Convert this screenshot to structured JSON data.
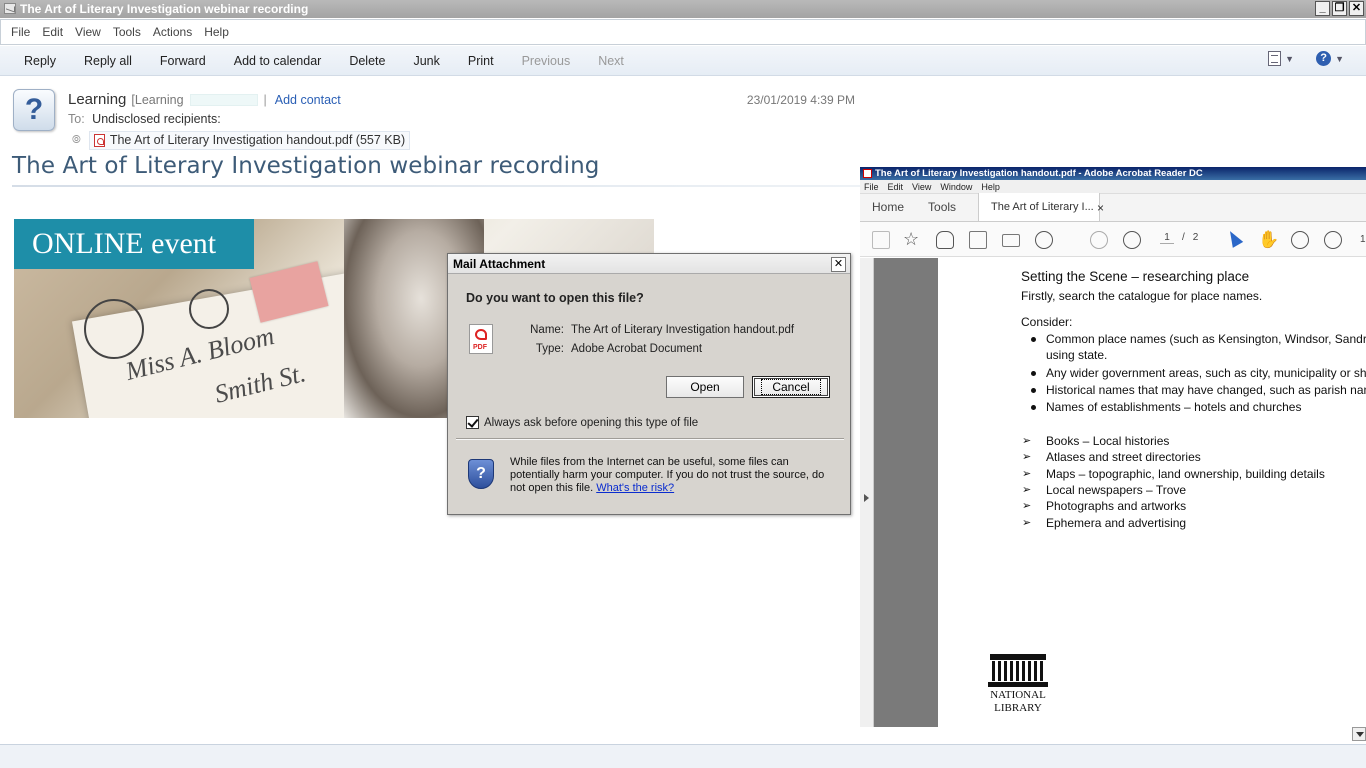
{
  "window": {
    "title": "The Art of Literary Investigation webinar recording",
    "controls": [
      "_",
      "❐",
      "✕"
    ]
  },
  "menu": [
    "File",
    "Edit",
    "View",
    "Tools",
    "Actions",
    "Help"
  ],
  "toolbar": {
    "buttons": [
      {
        "label": "Reply",
        "enabled": true
      },
      {
        "label": "Reply all",
        "enabled": true
      },
      {
        "label": "Forward",
        "enabled": true
      },
      {
        "label": "Add to calendar",
        "enabled": true
      },
      {
        "label": "Delete",
        "enabled": true
      },
      {
        "label": "Junk",
        "enabled": true
      },
      {
        "label": "Print",
        "enabled": true
      },
      {
        "label": "Previous",
        "enabled": false
      },
      {
        "label": "Next",
        "enabled": false
      }
    ],
    "right_icons": [
      "view-options-icon",
      "help-icon"
    ]
  },
  "message": {
    "from_name": "Learning",
    "from_bracket": "[Learning",
    "separator": "|",
    "add_contact": "Add contact",
    "date": "23/01/2019 4:39 PM",
    "to_label": "To:",
    "to_value": "Undisclosed recipients:",
    "attachment": "The Art of Literary Investigation handout.pdf (557 KB)",
    "subject": "The Art of Literary Investigation webinar recording",
    "banner_text": "ONLINE event"
  },
  "dialog": {
    "title": "Mail Attachment",
    "close": "✕",
    "question": "Do you want to open this file?",
    "name_label": "Name:",
    "name_value": "The Art of Literary Investigation handout.pdf",
    "type_label": "Type:",
    "type_value": "Adobe Acrobat Document",
    "open_button": "Open",
    "cancel_button": "Cancel",
    "checkbox_label": "Always ask before opening this type of file",
    "checkbox_checked": true,
    "warning_text": "While files from the Internet can be useful, some files can potentially harm your computer. If you do not trust the source, do not open this file.",
    "risk_link": "What's the risk?"
  },
  "acrobat": {
    "title": "The Art of Literary Investigation handout.pdf - Adobe Acrobat Reader DC",
    "menu": [
      "File",
      "Edit",
      "View",
      "Window",
      "Help"
    ],
    "tabs": {
      "home": "Home",
      "tools": "Tools",
      "doc": "The Art of Literary I..."
    },
    "tab_close": "×",
    "page_current": "1",
    "page_sep": "/",
    "page_total": "2",
    "zoom_partial": "1",
    "page": {
      "heading": "Setting the Scene – researching place",
      "intro": "Firstly, search the catalogue for place names.",
      "consider": "Consider:",
      "bullets": [
        "Common place names (such as Kensington, Windsor, Sandri",
        "using state.",
        "Any wider government areas, such as city, municipality or sh",
        "Historical names that may have changed, such as parish nan",
        "Names of establishments – hotels and churches"
      ],
      "arrow_items": [
        "Books – Local histories",
        "Atlases and street directories",
        "Maps – topographic, land ownership, building details",
        "Local newspapers – Trove",
        "Photographs and artworks",
        "Ephemera and advertising"
      ],
      "logo_line1": "NATIONAL",
      "logo_line2": "LIBRARY"
    }
  }
}
